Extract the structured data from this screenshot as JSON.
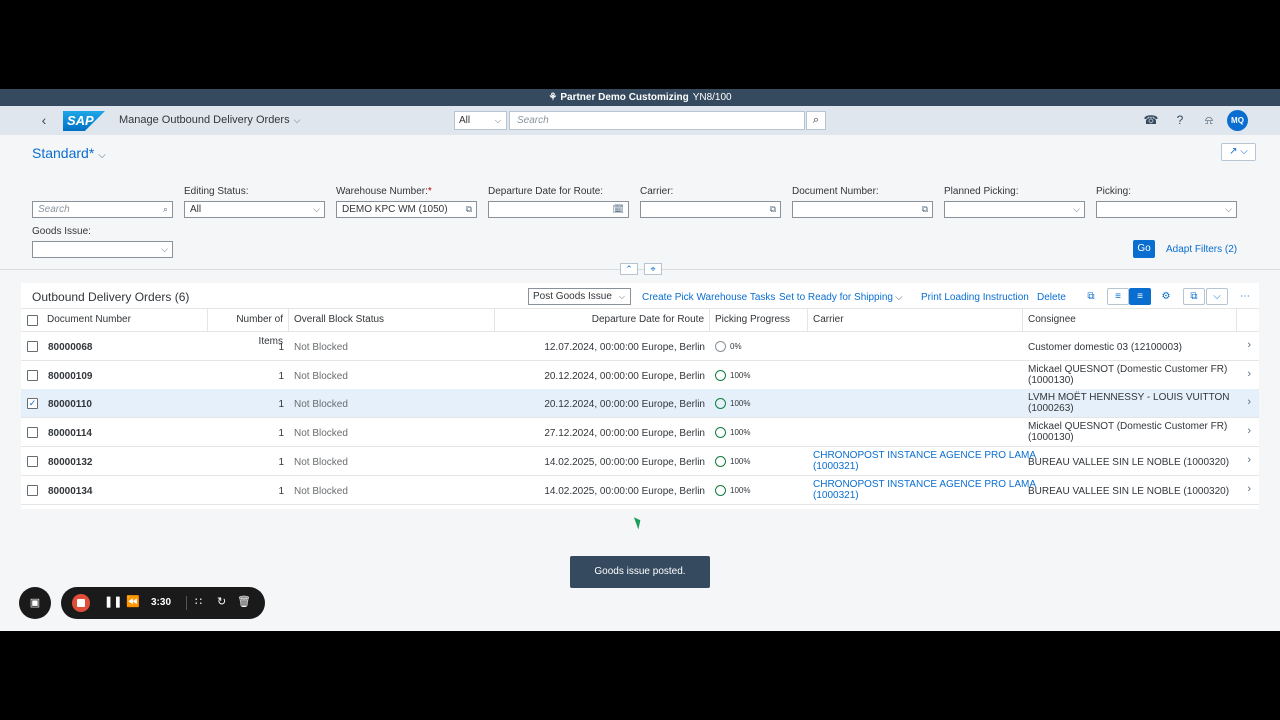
{
  "system_bar": {
    "title": "Partner Demo Customizing",
    "system_id": "YN8/100"
  },
  "shell": {
    "logo_text": "SAP",
    "app_title": "Manage Outbound Delivery Orders",
    "scope_value": "All",
    "search_placeholder": "Search",
    "avatar_initials": "MQ"
  },
  "filter_bar": {
    "variant_name": "Standard*",
    "search_placeholder": "Search",
    "filters": [
      {
        "label": "Editing Status:",
        "value": "All"
      },
      {
        "label": "Warehouse Number:",
        "required_mark": "*",
        "value": "DEMO KPC WM (1050)"
      },
      {
        "label": "Departure Date for Route:",
        "value": ""
      },
      {
        "label": "Carrier:",
        "value": ""
      },
      {
        "label": "Document Number:",
        "value": ""
      },
      {
        "label": "Planned Picking:",
        "value": ""
      },
      {
        "label": "Picking:",
        "value": ""
      },
      {
        "label": "Goods Issue:",
        "value": ""
      }
    ],
    "go_label": "Go",
    "adapt_filters_label": "Adapt Filters (2)"
  },
  "table": {
    "title": "Outbound Delivery Orders (6)",
    "toolbar": {
      "post_goods_issue": "Post Goods Issue",
      "create_pick_tasks": "Create Pick Warehouse Tasks",
      "ready_for_shipping": "Set to Ready for Shipping",
      "print_loading": "Print Loading Instruction",
      "delete": "Delete"
    },
    "columns": [
      "Document Number",
      "Number of Items",
      "Overall Block Status",
      "Departure Date for Route",
      "Picking Progress",
      "Carrier",
      "Consignee"
    ],
    "rows": [
      {
        "doc": "80000068",
        "items": "1",
        "block": "Not Blocked",
        "date": "12.07.2024, 00:00:00 Europe, Berlin",
        "progress": "0%",
        "progress_value": 0,
        "carrier_1": "",
        "carrier_2": "",
        "consignee_1": "Customer domestic 03 (12100003)",
        "consignee_2": "",
        "selected": false
      },
      {
        "doc": "80000109",
        "items": "1",
        "block": "Not Blocked",
        "date": "20.12.2024, 00:00:00 Europe, Berlin",
        "progress": "100%",
        "progress_value": 100,
        "carrier_1": "",
        "carrier_2": "",
        "consignee_1": "Mickael QUESNOT (Domestic Customer FR)",
        "consignee_2": "(1000130)",
        "selected": false
      },
      {
        "doc": "80000110",
        "items": "1",
        "block": "Not Blocked",
        "date": "20.12.2024, 00:00:00 Europe, Berlin",
        "progress": "100%",
        "progress_value": 100,
        "carrier_1": "",
        "carrier_2": "",
        "consignee_1": "LVMH MOËT HENNESSY - LOUIS VUITTON",
        "consignee_2": "(1000263)",
        "selected": true
      },
      {
        "doc": "80000114",
        "items": "1",
        "block": "Not Blocked",
        "date": "27.12.2024, 00:00:00 Europe, Berlin",
        "progress": "100%",
        "progress_value": 100,
        "carrier_1": "",
        "carrier_2": "",
        "consignee_1": "Mickael QUESNOT (Domestic Customer FR)",
        "consignee_2": "(1000130)",
        "selected": false
      },
      {
        "doc": "80000132",
        "items": "1",
        "block": "Not Blocked",
        "date": "14.02.2025, 00:00:00 Europe, Berlin",
        "progress": "100%",
        "progress_value": 100,
        "carrier_1": "CHRONOPOST INSTANCE AGENCE PRO LAMA",
        "carrier_2": "(1000321)",
        "consignee_1": "BUREAU VALLEE SIN LE NOBLE (1000320)",
        "consignee_2": "",
        "selected": false
      },
      {
        "doc": "80000134",
        "items": "1",
        "block": "Not Blocked",
        "date": "14.02.2025, 00:00:00 Europe, Berlin",
        "progress": "100%",
        "progress_value": 100,
        "carrier_1": "CHRONOPOST INSTANCE AGENCE PRO LAMA",
        "carrier_2": "(1000321)",
        "consignee_1": "BUREAU VALLEE SIN LE NOBLE (1000320)",
        "consignee_2": "",
        "selected": false
      }
    ]
  },
  "toast": {
    "message": "Goods issue posted."
  },
  "recorder": {
    "time": "3:30"
  },
  "colors": {
    "brand": "#0a6ed1",
    "shell": "#dfe6ee",
    "system_bar": "#354a5f",
    "success": "#107e3e",
    "record": "#e04e3a"
  }
}
